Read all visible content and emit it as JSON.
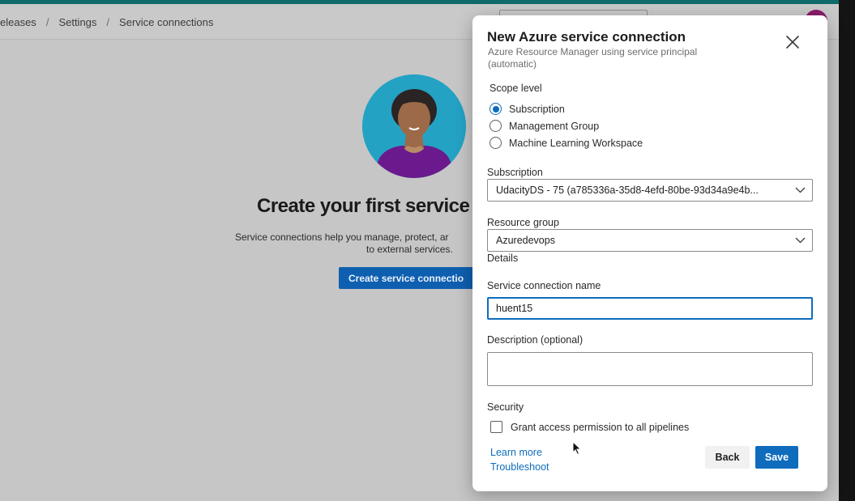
{
  "breadcrumb": {
    "items": [
      "eleases",
      "Settings",
      "Service connections"
    ],
    "separator": "/"
  },
  "empty_state": {
    "title": "Create your first service c",
    "description_line1": "Service connections help you manage, protect, ar",
    "description_line2": "to external services.",
    "button_label": "Create service connectio"
  },
  "dialog": {
    "title": "New Azure service connection",
    "subtitle": "Azure Resource Manager using service principal (automatic)",
    "scope": {
      "label": "Scope level",
      "options": [
        "Subscription",
        "Management Group",
        "Machine Learning Workspace"
      ],
      "selected": "Subscription"
    },
    "subscription": {
      "label": "Subscription",
      "value": "UdacityDS - 75 (a785336a-35d8-4efd-80be-93d34a9e4b..."
    },
    "resource_group": {
      "label": "Resource group",
      "value": "Azuredevops"
    },
    "details_heading": "Details",
    "connection_name": {
      "label": "Service connection name",
      "value": "huent15"
    },
    "description": {
      "label": "Description (optional)",
      "value": ""
    },
    "security": {
      "label": "Security",
      "checkbox_label": "Grant access permission to all pipelines",
      "checked": false
    },
    "links": {
      "learn_more": "Learn more",
      "troubleshoot": "Troubleshoot"
    },
    "buttons": {
      "back": "Back",
      "save": "Save"
    }
  },
  "colors": {
    "accent": "#0f6cbd",
    "top_bar": "#0f6b6b",
    "avatar": "#8a1c6b",
    "overlay_background": "#c6c6c6"
  }
}
